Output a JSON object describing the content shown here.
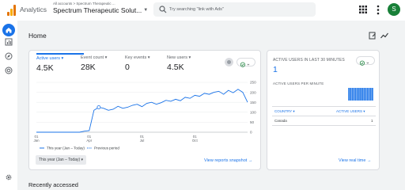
{
  "header": {
    "app_name": "Analytics",
    "account_crumb": "All accounts > Spectrum Therapeutic ...",
    "property": "Spectrum Therapeutic Solut...",
    "search_placeholder": "Try searching \"link with Ads\"",
    "avatar_initial": "S"
  },
  "page": {
    "title": "Home",
    "recently_accessed": "Recently accessed"
  },
  "metrics": [
    {
      "label": "Active users",
      "value": "4.5K",
      "active": true
    },
    {
      "label": "Event count",
      "value": "28K"
    },
    {
      "label": "Key events",
      "value": "0"
    },
    {
      "label": "New users",
      "value": "4.5K"
    }
  ],
  "metric_caret": "▾",
  "chart_data": {
    "type": "line",
    "x_tick_labels": [
      {
        "top": "01",
        "bottom": "Jan"
      },
      {
        "top": "01",
        "bottom": "Apr"
      },
      {
        "top": "01",
        "bottom": "Jul"
      },
      {
        "top": "01",
        "bottom": "Oct"
      }
    ],
    "y_ticks": [
      0,
      50,
      100,
      150,
      200,
      250
    ],
    "ylim": [
      0,
      250
    ],
    "series": [
      {
        "name": "This year (Jan – Today)",
        "values": [
          0,
          0,
          0,
          0,
          0,
          0,
          0,
          0,
          0,
          0,
          5,
          8,
          110,
          125,
          120,
          110,
          115,
          130,
          120,
          125,
          135,
          140,
          128,
          145,
          150,
          140,
          148,
          160,
          155,
          165,
          158,
          175,
          170,
          185,
          180,
          195,
          190,
          200,
          205,
          190,
          210,
          198,
          215,
          200,
          150
        ]
      },
      {
        "name": "Previous period",
        "values": []
      }
    ],
    "legend_position": "bottom-left"
  },
  "controls": {
    "period_label": "This year (Jan – Today) ▾",
    "view_snapshot": "View reports snapshot",
    "view_realtime": "View real time",
    "arrow": "→"
  },
  "realtime": {
    "title_active": "ACTIVE USERS IN LAST 30 MINUTES",
    "active_value": "1",
    "title_per_minute": "ACTIVE USERS PER MINUTE",
    "per_minute": [
      1,
      1,
      1,
      1,
      1,
      1,
      1,
      1,
      1,
      1,
      1,
      1,
      1,
      1,
      1
    ],
    "col_country": "COUNTRY",
    "col_users": "ACTIVE USERS",
    "rows": [
      {
        "country": "Canada",
        "users": "1"
      }
    ]
  },
  "colors": {
    "accent": "#1a73e8",
    "grid": "#e8eaed",
    "check": "#188038"
  }
}
